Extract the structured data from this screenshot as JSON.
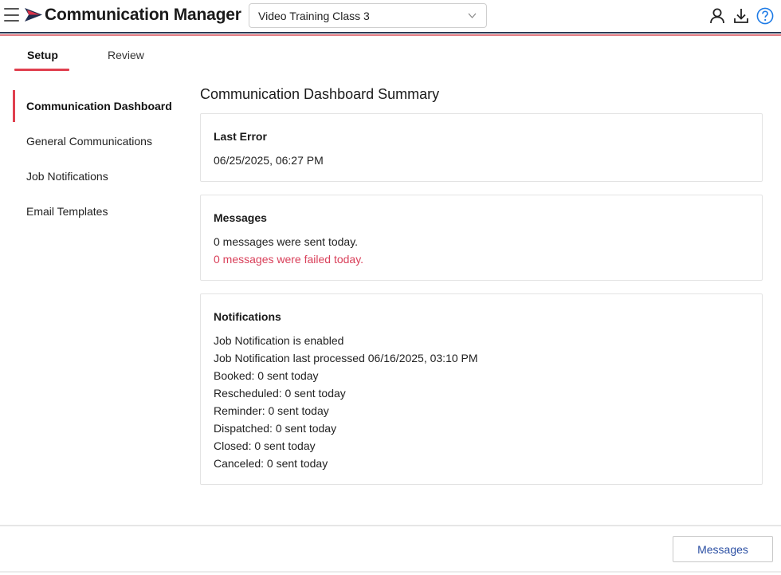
{
  "header": {
    "app_title": "Communication Manager",
    "menu_icon": "hamburger-menu-icon",
    "logo_icon": "paper-plane-logo-icon",
    "selector": {
      "value": "Video Training Class 3",
      "icon": "chevron-down-icon"
    },
    "actions": [
      {
        "icon": "user-icon"
      },
      {
        "icon": "download-icon"
      },
      {
        "icon": "help-icon"
      }
    ]
  },
  "tabs": [
    {
      "label": "Setup",
      "active": true
    },
    {
      "label": "Review",
      "active": false
    }
  ],
  "sidebar": {
    "items": [
      {
        "label": "Communication Dashboard",
        "active": true
      },
      {
        "label": "General Communications",
        "active": false
      },
      {
        "label": "Job Notifications",
        "active": false
      },
      {
        "label": "Email Templates",
        "active": false
      }
    ]
  },
  "main": {
    "title": "Communication Dashboard Summary",
    "last_error": {
      "title": "Last Error",
      "value": "06/25/2025, 06:27 PM"
    },
    "messages": {
      "title": "Messages",
      "sent": "0 messages were sent today.",
      "failed": "0 messages were failed today."
    },
    "notifications": {
      "title": "Notifications",
      "lines": [
        "Job Notification is enabled",
        "Job Notification last processed 06/16/2025, 03:10 PM",
        "Booked: 0 sent today",
        "Rescheduled: 0 sent today",
        "Reminder: 0 sent today",
        "Dispatched: 0 sent today",
        "Closed: 0 sent today",
        "Canceled: 0 sent today"
      ]
    }
  },
  "footer": {
    "messages_button": "Messages"
  },
  "colors": {
    "accent": "#e0404f",
    "error_text": "#d9405a",
    "link_blue": "#2b4fa3",
    "help_blue": "#1e7be6",
    "navy": "#2b3a55"
  }
}
